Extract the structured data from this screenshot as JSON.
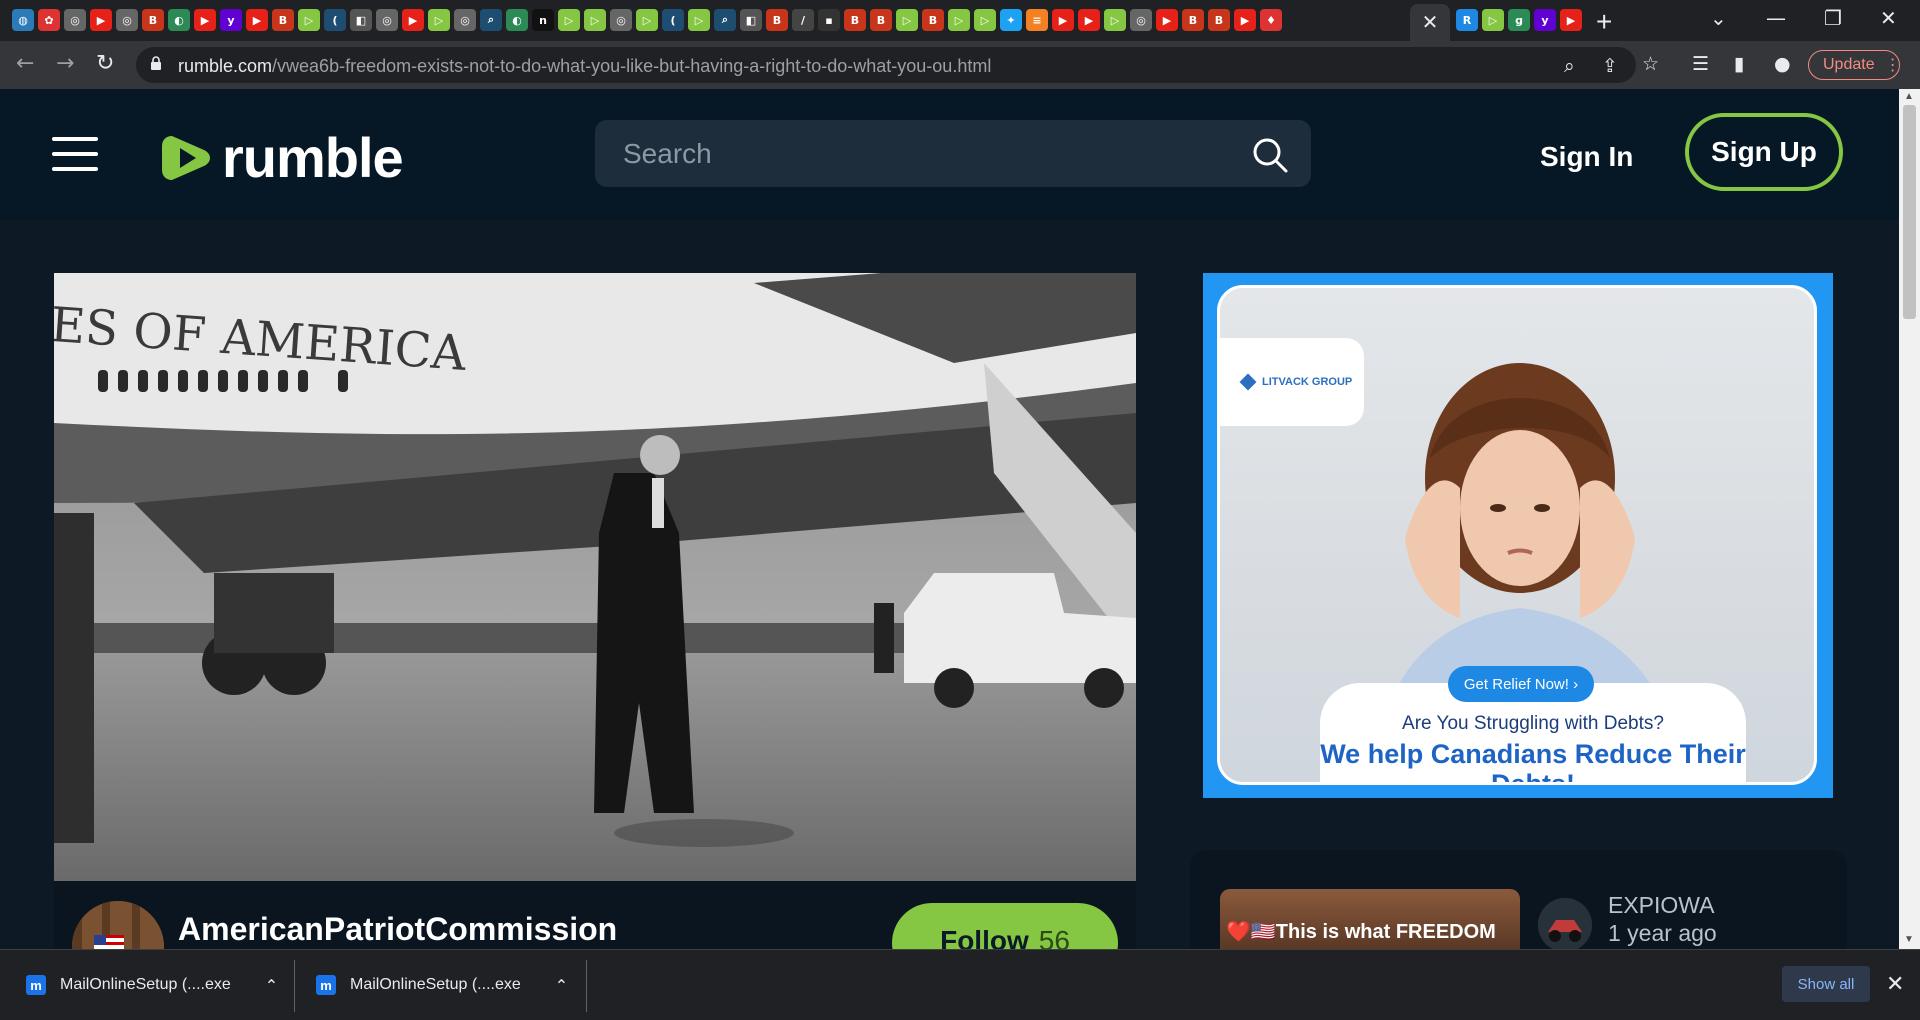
{
  "browser": {
    "active_tab_close": "✕",
    "new_tab": "+",
    "url_host": "rumble.com",
    "url_path": "/vwea6b-freedom-exists-not-to-do-what-you-like-but-having-a-right-to-do-what-you-ou.html",
    "update_label": "Update"
  },
  "header": {
    "logo_text": "rumble",
    "search_placeholder": "Search",
    "signin_label": "Sign In",
    "signup_label": "Sign Up"
  },
  "video": {
    "channel_name": "AmericanPatriotCommission",
    "follow_label": "Follow",
    "follow_count": "56",
    "frame_text": "ES OF AMERICA"
  },
  "ad": {
    "brand": "LITVACK GROUP",
    "cta": "Get Relief Now!  ›",
    "question": "Are You Struggling with Debts?",
    "headline": "We help Canadians Reduce Their Debts!"
  },
  "related": {
    "title": "❤️🇺🇸This is what FREEDOM",
    "channel": "EXPIOWA",
    "time": "1 year ago"
  },
  "downloads": {
    "items": [
      {
        "name": "MailOnlineSetup (....exe"
      },
      {
        "name": "MailOnlineSetup (....exe"
      }
    ],
    "show_all": "Show all"
  },
  "colors": {
    "accent_green": "#85c742",
    "header_bg": "#061726",
    "ad_blue": "#2196f3"
  }
}
